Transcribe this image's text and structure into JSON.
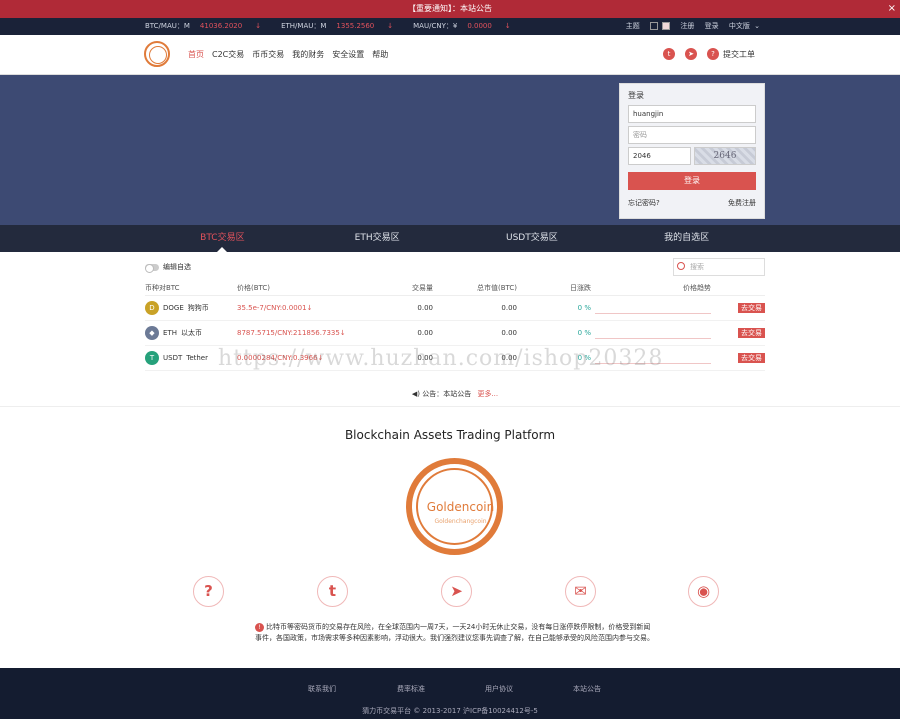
{
  "notice": {
    "text": "【重要通知】：本站公告",
    "close": "×"
  },
  "ticker": {
    "items": [
      {
        "label": "BTC/MAU：M",
        "value": "41036.2020",
        "sep": "↓"
      },
      {
        "label": "ETH/MAU：M",
        "value": "1355.2560",
        "sep": "↓"
      },
      {
        "label": "MAU/CNY：¥",
        "value": "0.0000",
        "sep": "↓"
      }
    ],
    "theme_label": "主题",
    "register": "注册",
    "login": "登录",
    "language": "中文版"
  },
  "nav": {
    "menu": [
      "首页",
      "C2C交易",
      "币币交易",
      "我的财务",
      "安全设置",
      "帮助"
    ],
    "submit_ticket": "提交工单"
  },
  "login_box": {
    "title": "登录",
    "username_value": "huangjin",
    "password_placeholder": "密码",
    "captcha_value": "2046",
    "captcha_image": "2646",
    "button": "登录",
    "forgot": "忘记密码?",
    "register": "免费注册"
  },
  "tabs": [
    "BTC交易区",
    "ETH交易区",
    "USDT交易区",
    "我的自选区"
  ],
  "market": {
    "toggle_label": "编辑自选",
    "search_placeholder": "搜索",
    "headers": [
      "币种对BTC",
      "价格(BTC)",
      "交易量",
      "总市值(BTC)",
      "日涨跌",
      "价格趋势"
    ],
    "rows": [
      {
        "symbol": "DOGE",
        "name": "狗狗币",
        "price": "35.5e-7/CNY:0.0001",
        "arrow": "↓",
        "volume": "0.00",
        "cap": "0.00",
        "change": "0 %",
        "trade": "去交易",
        "color": "#c9a227",
        "glyph": "D"
      },
      {
        "symbol": "ETH",
        "name": "以太币",
        "price": "8787.5715/CNY:211856.7335",
        "arrow": "↓",
        "volume": "0.00",
        "cap": "0.00",
        "change": "0 %",
        "trade": "去交易",
        "color": "#6c7a96",
        "glyph": "◆"
      },
      {
        "symbol": "USDT",
        "name": "Tether",
        "price": "0.0000284/CNY:0.3966",
        "arrow": "↓",
        "volume": "0.00",
        "cap": "0.00",
        "change": "0 %",
        "trade": "去交易",
        "color": "#26a17b",
        "glyph": "T"
      }
    ],
    "announcement": "公告：本站公告",
    "more": "更多..."
  },
  "platform_title": "Blockchain Assets Trading Platform",
  "brand": {
    "name": "Goldencoin",
    "sub": "Goldenchangcoin"
  },
  "socials": [
    {
      "name": "help",
      "glyph": "?"
    },
    {
      "name": "twitter",
      "glyph": "t"
    },
    {
      "name": "telegram",
      "glyph": "➤"
    },
    {
      "name": "email",
      "glyph": "✉"
    },
    {
      "name": "github",
      "glyph": "◉"
    }
  ],
  "risk_text": "比特币等密码货币的交易存在风险，在全球范围内一周7天，一天24小时无休止交易，没有每日涨停跌停限制，价格受到新闻事件，各国政策，市场需求等多种因素影响，浮动很大。我们强烈建议您事先调查了解，在自己能够承受的风险范围内参与交易。",
  "footer": {
    "links": [
      "联系我们",
      "费率标准",
      "用户协议",
      "本站公告"
    ],
    "copyright": "猜力币交易平台 © 2013-2017 沪ICP备10024412号-5"
  },
  "watermark": "https://www.huzhan.com/ishop20328"
}
